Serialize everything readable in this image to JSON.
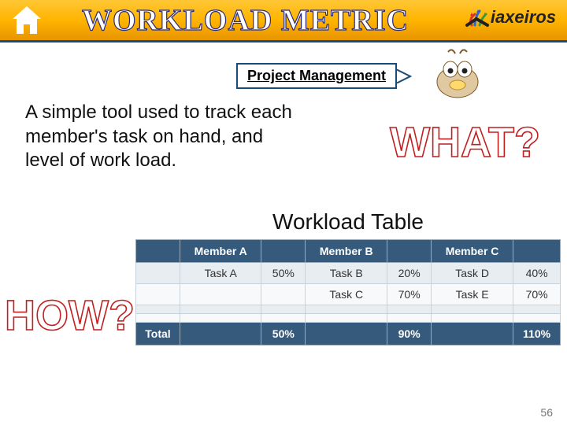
{
  "header": {
    "title": "WORKLOAD METRIC",
    "brand": "iaxeiros"
  },
  "pm_label": "Project Management",
  "body_text": "A simple tool used to track each member's task on hand, and level of work load.",
  "what_label": "WHAT?",
  "how_label": "HOW?",
  "table": {
    "title": "Workload Table",
    "headers": [
      "",
      "Member A",
      "",
      "Member B",
      "",
      "Member C",
      ""
    ],
    "rows": [
      [
        "",
        "Task A",
        "50%",
        "Task B",
        "20%",
        "Task D",
        "40%"
      ],
      [
        "",
        "",
        "",
        "Task C",
        "70%",
        "Task E",
        "70%"
      ],
      [
        "",
        "",
        "",
        "",
        "",
        "",
        ""
      ],
      [
        "",
        "",
        "",
        "",
        "",
        "",
        ""
      ]
    ],
    "footer": [
      "Total",
      "",
      "50%",
      "",
      "90%",
      "",
      "110%"
    ]
  },
  "page_number": "56"
}
